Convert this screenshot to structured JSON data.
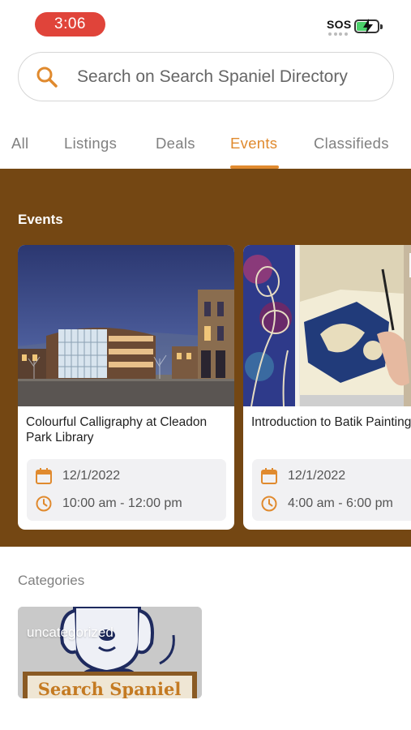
{
  "status_bar": {
    "time": "3:06",
    "sos": "SOS"
  },
  "search": {
    "placeholder": "Search on Search Spaniel Directory"
  },
  "tabs": [
    {
      "label": "All"
    },
    {
      "label": "Listings"
    },
    {
      "label": "Deals"
    },
    {
      "label": "Events",
      "active": true
    },
    {
      "label": "Classifieds"
    }
  ],
  "events": {
    "title": "Events",
    "cards": [
      {
        "title": "Colourful Calligraphy at Cleadon Park Library",
        "date": "12/1/2022",
        "time": "10:00 am - 12:00 pm"
      },
      {
        "title": "Introduction to Batik Painting",
        "date": "12/1/2022",
        "time": "4:00 am - 6:00 pm"
      }
    ]
  },
  "categories": {
    "title": "Categories",
    "items": [
      {
        "label": "uncategorized",
        "logo_text": "Search Spaniel"
      }
    ]
  },
  "colors": {
    "accent": "#e08a2e",
    "events_background": "#744713",
    "time_pill": "#e0443a"
  }
}
